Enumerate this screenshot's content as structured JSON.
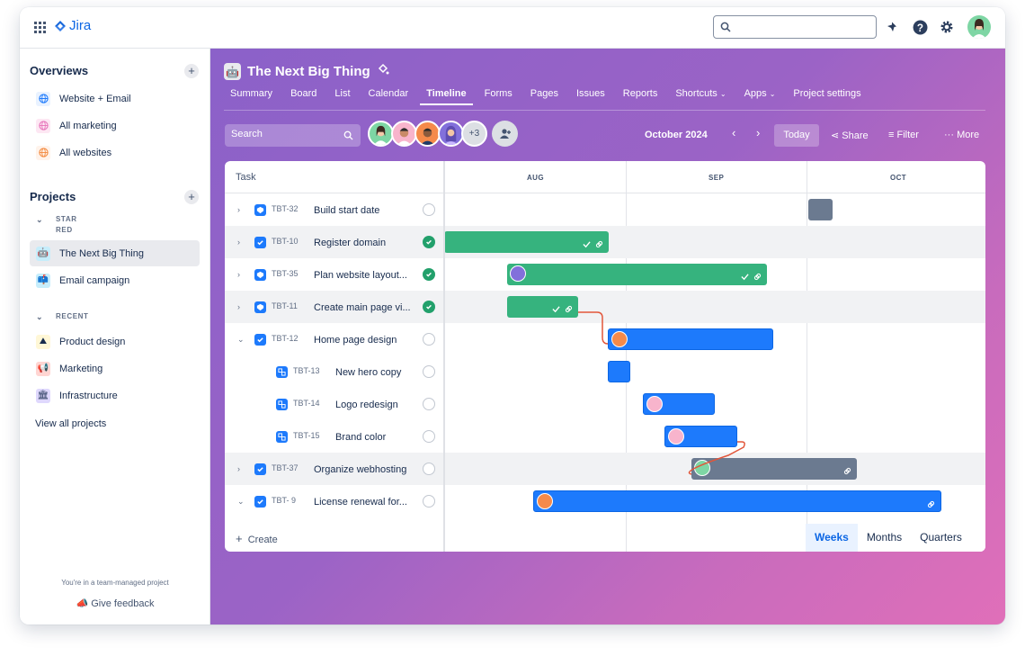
{
  "topbar": {
    "app_name": "Jira"
  },
  "sidebar": {
    "overviews_title": "Overviews",
    "overviews": [
      {
        "label": "Website + Email",
        "icon": "globe-icon",
        "color": "#1d7afc"
      },
      {
        "label": "All marketing",
        "icon": "globe-icon",
        "color": "#e774bb"
      },
      {
        "label": "All websites",
        "icon": "globe-icon",
        "color": "#f38a3f"
      }
    ],
    "projects_title": "Projects",
    "starred_label": "STAR\nRED",
    "starred": [
      {
        "label": "The Next Big Thing",
        "icon": "robot-icon"
      },
      {
        "label": "Email campaign",
        "icon": "mailbox-icon"
      }
    ],
    "recent_label": "RECENT",
    "recent": [
      {
        "label": "Product design",
        "icon": "drafting-icon"
      },
      {
        "label": "Marketing",
        "icon": "megaphone-icon"
      },
      {
        "label": "Infrastructure",
        "icon": "server-icon"
      }
    ],
    "view_all": "View all projects",
    "footer_note": "You're in a team-managed project",
    "feedback": "Give feedback"
  },
  "project": {
    "title": "The Next Big Thing",
    "tabs": [
      "Summary",
      "Board",
      "List",
      "Calendar",
      "Timeline",
      "Forms",
      "Pages",
      "Issues",
      "Reports",
      "Shortcuts",
      "Apps",
      "Project settings"
    ],
    "active_tab": "Timeline"
  },
  "toolbar": {
    "search_placeholder": "Search",
    "more_avatars": "+3",
    "month_label": "October 2024",
    "today": "Today",
    "share": "Share",
    "filter": "Filter",
    "more": "More"
  },
  "timeline": {
    "task_header": "Task",
    "months": [
      "AUG",
      "SEP",
      "OCT"
    ],
    "create": "Create",
    "zoom": [
      "Weeks",
      "Months",
      "Quarters"
    ],
    "active_zoom": "Weeks",
    "rows": [
      {
        "key": "TBT-32",
        "name": "Build start date",
        "status": "open",
        "type": "epic"
      },
      {
        "key": "TBT-10",
        "name": "Register domain",
        "status": "done",
        "type": "task"
      },
      {
        "key": "TBT-35",
        "name": "Plan website layout...",
        "status": "done",
        "type": "epic"
      },
      {
        "key": "TBT-11",
        "name": "Create main page vi...",
        "status": "done",
        "type": "epic"
      },
      {
        "key": "TBT-12",
        "name": "Home page design",
        "status": "open",
        "type": "task"
      },
      {
        "key": "TBT-13",
        "name": "New hero copy",
        "status": "open",
        "type": "subtask"
      },
      {
        "key": "TBT-14",
        "name": "Logo redesign",
        "status": "open",
        "type": "subtask"
      },
      {
        "key": "TBT-15",
        "name": "Brand color",
        "status": "open",
        "type": "subtask"
      },
      {
        "key": "TBT-37",
        "name": "Organize webhosting",
        "status": "open",
        "type": "task"
      },
      {
        "key": "TBT- 9",
        "name": "License renewal for...",
        "status": "open",
        "type": "task"
      }
    ]
  },
  "colors": {
    "green": "#36b37e",
    "blue": "#1d7afc",
    "gray": "#6b7a90",
    "link": "#e2563a"
  }
}
